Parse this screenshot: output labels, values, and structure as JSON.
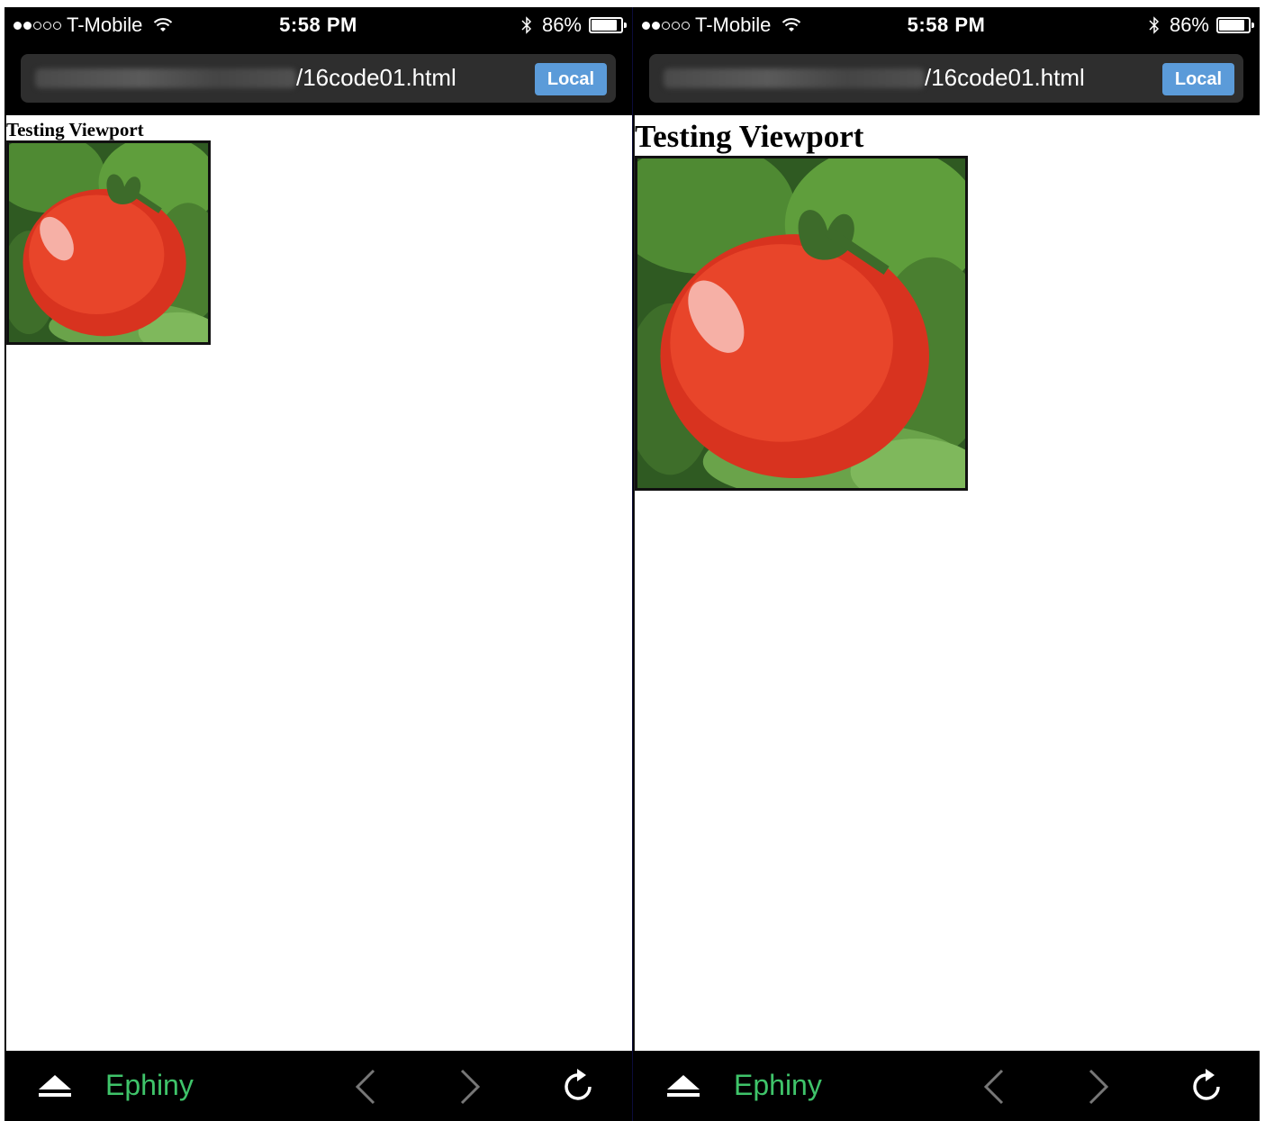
{
  "screens": [
    {
      "status": {
        "carrier": "T-Mobile",
        "time": "5:58 PM",
        "battery": "86%",
        "battery_level": 0.86,
        "signal_bars_filled": 2,
        "signal_bars_total": 5
      },
      "url": {
        "visible_path": "/16code01.html",
        "local_button": "Local"
      },
      "page": {
        "heading": "Testing Viewport",
        "image": "tomato-photo"
      },
      "toolbar": {
        "app_name": "Ephiny"
      }
    },
    {
      "status": {
        "carrier": "T-Mobile",
        "time": "5:58 PM",
        "battery": "86%",
        "battery_level": 0.86,
        "signal_bars_filled": 2,
        "signal_bars_total": 5
      },
      "url": {
        "visible_path": "/16code01.html",
        "local_button": "Local"
      },
      "page": {
        "heading": "Testing Viewport",
        "image": "tomato-photo"
      },
      "toolbar": {
        "app_name": "Ephiny"
      }
    }
  ],
  "colors": {
    "accent_green": "#3fc46a",
    "local_button_blue": "#5b9bd9",
    "chrome_black": "#000000"
  }
}
